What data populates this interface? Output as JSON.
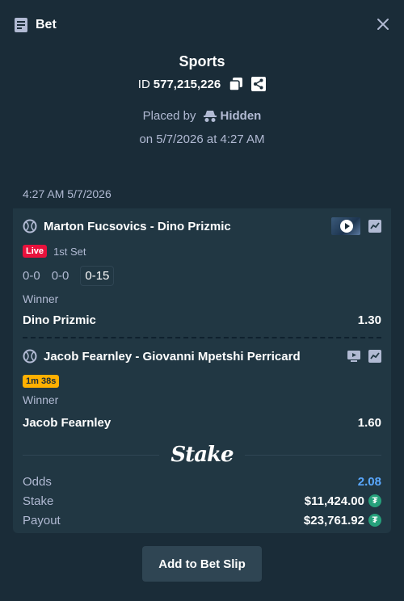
{
  "header": {
    "title": "Bet"
  },
  "summary": {
    "sport": "Sports",
    "id_label": "ID",
    "id_number": "577,215,226",
    "placed_by_label": "Placed by",
    "placed_by_user": "Hidden",
    "placed_on": "on 5/7/2026 at 4:27 AM"
  },
  "card": {
    "date": "4:27 AM 5/7/2026",
    "legs": [
      {
        "match": "Marton Fucsovics - Dino Prizmic",
        "status_badge": "Live",
        "status_text": "1st Set",
        "scores": [
          "0-0",
          "0-0",
          "0-15"
        ],
        "market": "Winner",
        "pick": "Dino Prizmic",
        "odds": "1.30"
      },
      {
        "match": "Jacob Fearnley - Giovanni Mpetshi Perricard",
        "status_badge": "1m 38s",
        "market": "Winner",
        "pick": "Jacob Fearnley",
        "odds": "1.60"
      }
    ],
    "brand": "Stake",
    "totals": {
      "odds_label": "Odds",
      "odds_value": "2.08",
      "stake_label": "Stake",
      "stake_value": "$11,424.00",
      "payout_label": "Payout",
      "payout_value": "$23,761.92",
      "coin_symbol": "₮"
    }
  },
  "actions": {
    "add_label": "Add to Bet Slip"
  },
  "colors": {
    "background": "#1a2c38",
    "card": "#213743",
    "live": "#e9113c",
    "timer": "#ffb000",
    "odds": "#5aa8ff",
    "coin": "#26a17b"
  }
}
